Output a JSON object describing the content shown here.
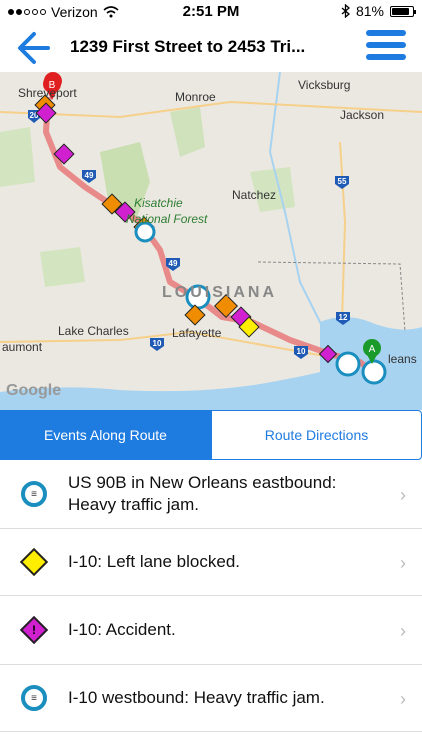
{
  "status": {
    "carrier": "Verizon",
    "time": "2:51 PM",
    "battery": "81%",
    "battery_level": 0.81
  },
  "header": {
    "title": "1239 First Street to 2453 Tri..."
  },
  "map": {
    "cities": [
      "Shreveport",
      "Monroe",
      "Vicksburg",
      "Jackson",
      "Natchez",
      "Lake Charles",
      "Lafayette",
      "aumont",
      "leans"
    ],
    "state": "LOUISIANA",
    "forest": [
      "Kisatchie",
      "National Forest"
    ],
    "routes": [
      "49",
      "49",
      "55",
      "12",
      "10",
      "10",
      "10",
      "20"
    ],
    "markers": [
      "A",
      "B"
    ],
    "attribution": "Google"
  },
  "tabs": [
    {
      "label": "Events Along Route"
    },
    {
      "label": "Route Directions"
    }
  ],
  "events": [
    {
      "text": "US 90B in New Orleans eastbound: Heavy traffic jam.",
      "icon": "traffic-jam-icon"
    },
    {
      "text": "I-10: Left lane blocked.",
      "icon": "lane-blocked-icon"
    },
    {
      "text": "I-10: Accident.",
      "icon": "accident-icon"
    },
    {
      "text": "I-10 westbound: Heavy traffic jam.",
      "icon": "traffic-jam-icon"
    }
  ],
  "colors": {
    "accent": "#1e7be0",
    "route": "#e88080",
    "accident": "#d020d0",
    "lane": "#ffee00"
  }
}
